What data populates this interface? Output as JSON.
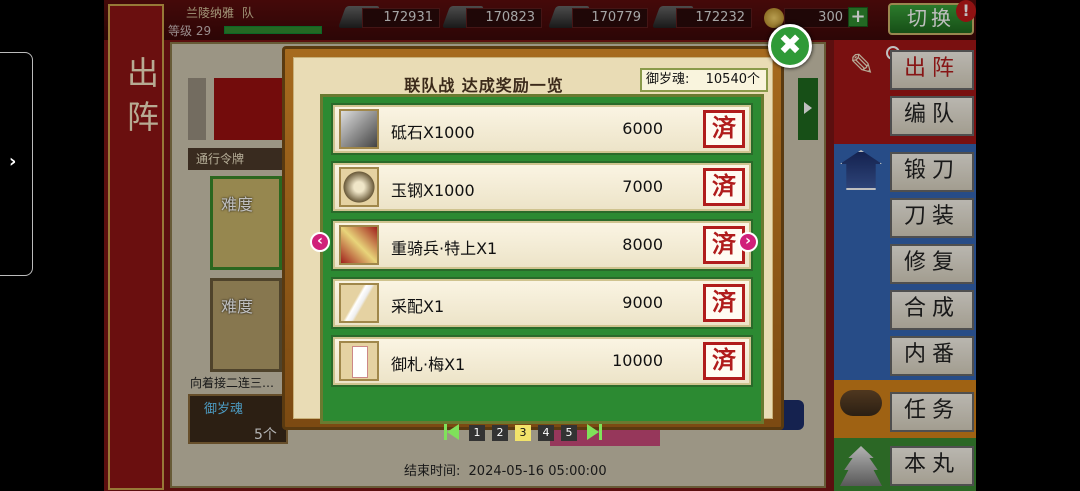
{
  "system": {
    "side_handle_icon": "chevron-right-icon",
    "side_handle_glyph": "›"
  },
  "player": {
    "name": "兰陵纳雅",
    "team_label": "队",
    "level_label": "等级",
    "level": "29",
    "exp_fraction": 1.0
  },
  "resources": [
    {
      "icon": "charcoal-icon",
      "value": "172931"
    },
    {
      "icon": "tamahagane-icon",
      "value": "170823"
    },
    {
      "icon": "cooling-material-icon",
      "value": "170779"
    },
    {
      "icon": "whetstone-icon",
      "value": "172232"
    }
  ],
  "koban": {
    "icon": "koban-icon",
    "value": "300",
    "plus": "+"
  },
  "switch_button": "切换",
  "alert_glyph": "!",
  "left_banner": "出阵",
  "scene": {
    "pass_label": "通行令牌",
    "card1_label": "难度",
    "card2_label": "难度",
    "description": "向着接二连三…",
    "reward_label": "御岁魂",
    "reward_count": "5个",
    "end_time_label": "结束时间:",
    "end_time": "2024-05-16 05:00:00"
  },
  "right_menu": [
    {
      "label": "出阵",
      "active": true
    },
    {
      "label": "编队"
    },
    {
      "label": "锻刀"
    },
    {
      "label": "刀装"
    },
    {
      "label": "修复"
    },
    {
      "label": "合成"
    },
    {
      "label": "内番"
    },
    {
      "label": "任务"
    },
    {
      "label": "本丸"
    }
  ],
  "dialog": {
    "title": "联队战 达成奖励一览",
    "soul_label": "御岁魂:",
    "soul_value": "10540个",
    "close_glyph": "✖",
    "items": [
      {
        "icon": "whetstone-icon",
        "name": "砥石X1000",
        "points": "6000",
        "status": "済"
      },
      {
        "icon": "tamahagane-icon",
        "name": "玉钢X1000",
        "points": "7000",
        "status": "済"
      },
      {
        "icon": "heavy-cavalry-icon",
        "name": "重骑兵·特上X1",
        "points": "8000",
        "status": "済"
      },
      {
        "icon": "saihai-icon",
        "name": "采配X1",
        "points": "9000",
        "status": "済"
      },
      {
        "icon": "ofuda-icon",
        "name": "御札·梅X1",
        "points": "10000",
        "status": "済"
      }
    ],
    "pager": {
      "pages": [
        "1",
        "2",
        "3",
        "4",
        "5"
      ],
      "current": "3"
    },
    "prev_glyph": "‹",
    "next_glyph": "›"
  },
  "colors": {
    "accent_green": "#2f9a37",
    "stamp_red": "#b01c1c",
    "frame_wood": "#a66a1e"
  }
}
